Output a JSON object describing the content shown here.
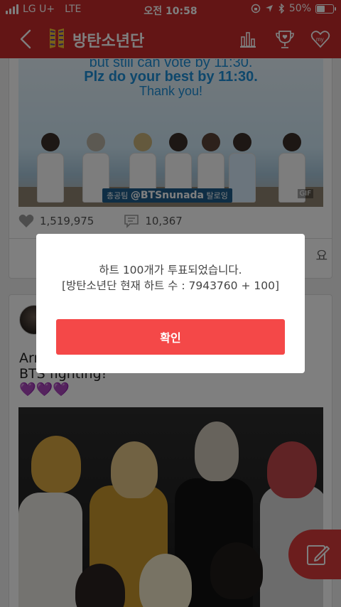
{
  "status_bar": {
    "carrier": "LG U+",
    "network": "LTE",
    "time": "오전 10:58",
    "battery": "50%",
    "battery_level": 0.5
  },
  "nav": {
    "title": "방탄소년단",
    "icons": [
      "back-chevron",
      "ranking-chart",
      "trophy-heart",
      "my-heart"
    ]
  },
  "feed": {
    "post1": {
      "image_text": {
        "line1": "but still can vote by 11:30.",
        "line2": "Plz do your best by 11:30.",
        "line3": "Thank you!"
      },
      "image_tag": "@BTSnunada",
      "gif_badge": "GIF",
      "likes": "1,519,975",
      "comments": "10,367",
      "footer_partial": "요"
    },
    "post2": {
      "text": "Arm\nBTS fighting!\n💜💜💜"
    }
  },
  "dialog": {
    "line1": "하트 100개가 투표되었습니다.",
    "line2": "[방탄소년단 현재 하트 수 : 7943760 + 100]",
    "confirm": "확인"
  },
  "colors": {
    "brand": "#c62a2a",
    "confirm_button": "#f44848",
    "fab": "#d93a3a"
  }
}
